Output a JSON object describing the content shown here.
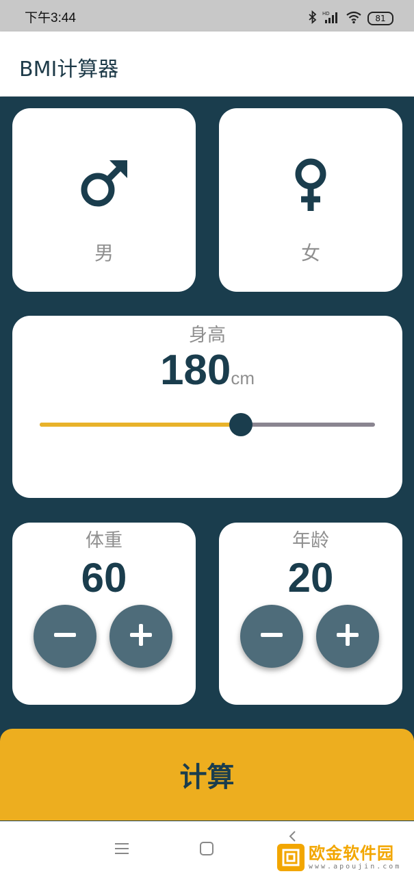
{
  "status_bar": {
    "time": "下午3:44",
    "battery": "81",
    "icons": [
      "bluetooth-icon",
      "hd-signal-icon",
      "wifi-icon",
      "battery-icon"
    ]
  },
  "app_bar": {
    "title": "BMI计算器"
  },
  "gender": {
    "male_label": "男",
    "female_label": "女",
    "male_icon": "male-symbol-icon",
    "female_icon": "female-symbol-icon"
  },
  "height": {
    "label": "身高",
    "value": "180",
    "unit": "cm",
    "slider_fraction": 0.6
  },
  "weight": {
    "label": "体重",
    "value": "60",
    "minus_icon": "minus-icon",
    "plus_icon": "plus-icon"
  },
  "age": {
    "label": "年龄",
    "value": "20",
    "minus_icon": "minus-icon",
    "plus_icon": "plus-icon"
  },
  "calculate_button": {
    "label": "计算"
  },
  "nav_bar": {
    "icons": [
      "menu-icon",
      "home-square-icon",
      "back-icon"
    ]
  },
  "watermark": {
    "main": "欧金软件园",
    "sub": "www.apoujin.com"
  },
  "colors": {
    "background": "#1a3d4d",
    "card": "#ffffff",
    "accent": "#edae1f",
    "slider_active": "#e8b22a",
    "slider_inactive": "#8a8590",
    "round_button": "#4e6c7a",
    "label_gray": "#8f8f8f"
  }
}
